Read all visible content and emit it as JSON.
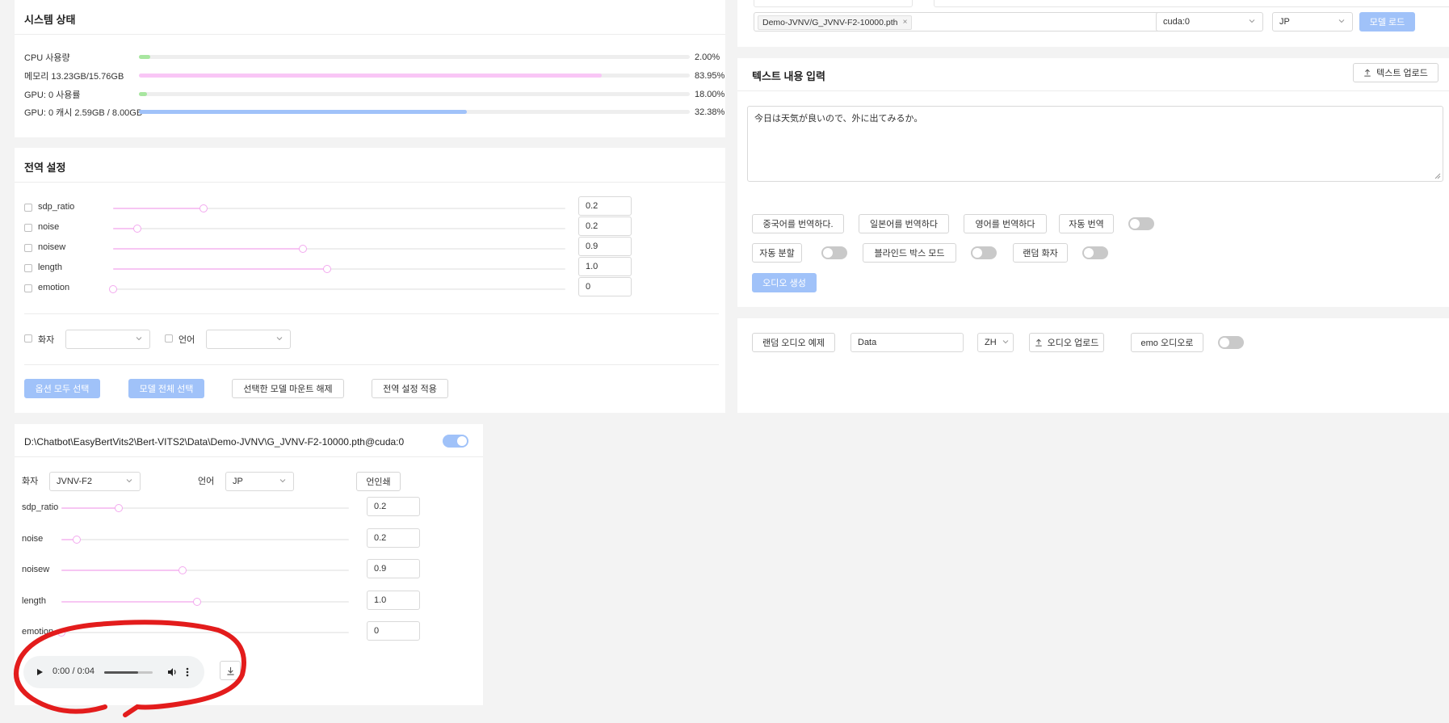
{
  "system": {
    "title": "시스템 상태",
    "rows": [
      {
        "label": "CPU 사용량",
        "value": "2.00%",
        "pct": 2.0,
        "color": "#a8e6a0"
      },
      {
        "label": "메모리 13.23GB/15.76GB",
        "value": "83.95%",
        "pct": 83.95,
        "color": "#f9c6f6"
      },
      {
        "label": "GPU: 0 사용률",
        "value": "18.00%",
        "pct": 1.5,
        "color": "#a8e6a0"
      },
      {
        "label": "GPU: 0 캐시 2.59GB / 8.00GB",
        "value": "32.38%",
        "pct": 59.5,
        "color": "#a0c2f9"
      }
    ]
  },
  "global": {
    "title": "전역 설정",
    "sliders": [
      {
        "label": "sdp_ratio",
        "value": "0.2",
        "pos": 0.2
      },
      {
        "label": "noise",
        "value": "0.2",
        "pos": 0.053
      },
      {
        "label": "noisew",
        "value": "0.9",
        "pos": 0.42
      },
      {
        "label": "length",
        "value": "1.0",
        "pos": 0.473
      },
      {
        "label": "emotion",
        "value": "0",
        "pos": 0
      }
    ],
    "speaker_label": "화자",
    "language_label": "언어",
    "buttons": {
      "select_all_options": "옵션 모두 선택",
      "select_all_models": "모델 전체 선택",
      "unmount_selected": "선택한 모델 마운트 해제",
      "apply_global": "전역 설정 적용"
    }
  },
  "model_panel": {
    "path": "D:\\Chatbot\\EasyBertVits2\\Bert-VITS2\\Data\\Demo-JVNV\\G_JVNV-F2-10000.pth@cuda:0",
    "speaker_label": "화자",
    "speaker_value": "JVNV-F2",
    "language_label": "언어",
    "language_value": "JP",
    "print_button": "언인쇄",
    "sliders": [
      {
        "label": "sdp_ratio",
        "value": "0.2",
        "pos": 0.2
      },
      {
        "label": "noise",
        "value": "0.2",
        "pos": 0.053
      },
      {
        "label": "noisew",
        "value": "0.9",
        "pos": 0.42
      },
      {
        "label": "length",
        "value": "1.0",
        "pos": 0.473
      },
      {
        "label": "emotion",
        "value": "0",
        "pos": 0
      }
    ],
    "audio": {
      "time": "0:00 / 0:04",
      "progress": 0.7
    }
  },
  "model_load": {
    "model_tag": "Demo-JVNV/G_JVNV-F2-10000.pth",
    "device": "cuda:0",
    "language": "JP",
    "load_button": "모델 로드"
  },
  "text_input": {
    "title": "텍스트 내용 입력",
    "upload_button": "텍스트 업로드",
    "content": "今日は天気が良いので、外に出てみるか。",
    "translate_zh": "중국어를 번역하다.",
    "translate_jp": "일본어를 번역하다",
    "translate_en": "영어를 번역하다",
    "auto_translate": "자동 번역",
    "auto_split": "자동 분할",
    "blind_box": "블라인드 박스 모드",
    "random_speaker": "랜덤 화자",
    "generate_button": "오디오 생성"
  },
  "audio_example": {
    "random_example": "랜덤 오디오 예제",
    "data_value": "Data",
    "lang": "ZH",
    "upload_audio": "오디오 업로드",
    "emo_audio": "emo 오디오로"
  }
}
